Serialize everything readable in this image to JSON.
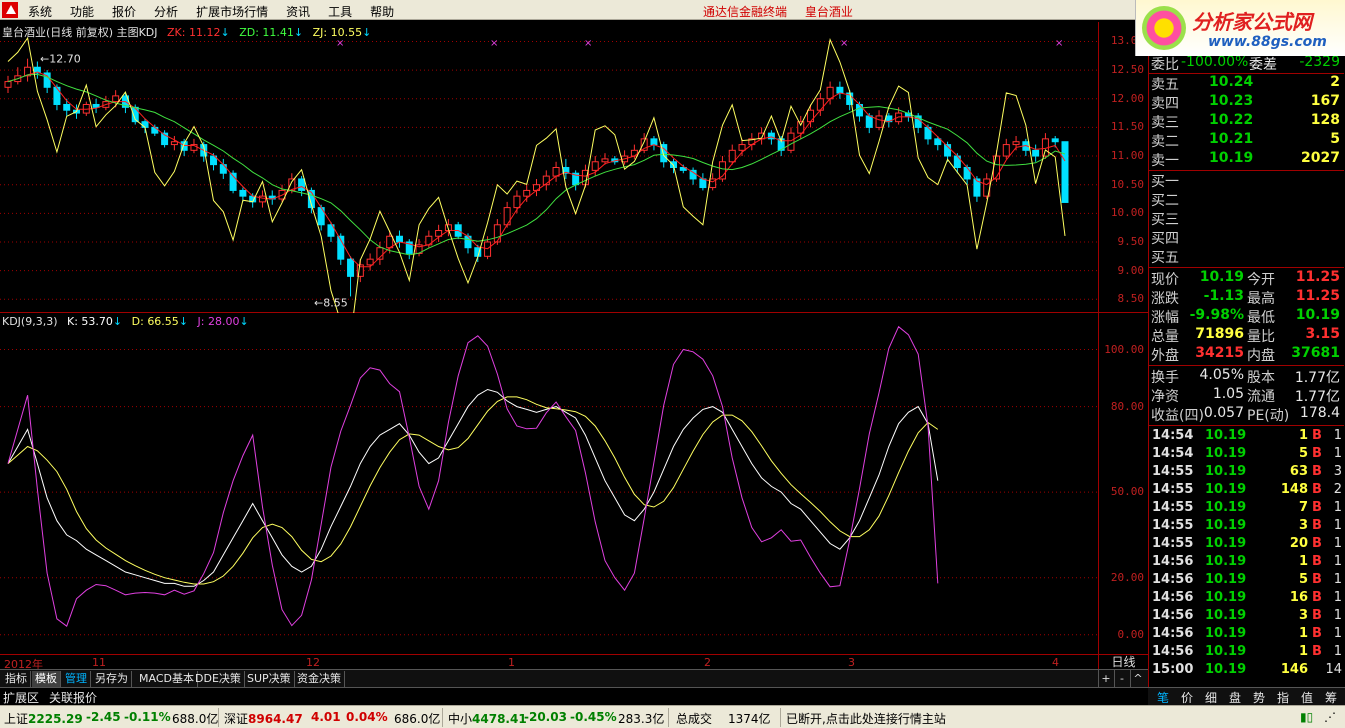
{
  "menu": {
    "items": [
      "系统",
      "功能",
      "报价",
      "分析",
      "扩展市场行情",
      "资讯",
      "工具",
      "帮助"
    ],
    "center": [
      "通达信金融终端",
      "皇台酒业"
    ]
  },
  "brand": {
    "name": "分析家公式网",
    "url": "www.88gs.com"
  },
  "price_pane": {
    "title": "皇台酒业(日线 前复权) 主图KDJ",
    "zk": "ZK: 11.12",
    "zd": "ZD: 11.41",
    "zj": "ZJ: 10.55",
    "max_label": "12.70",
    "min_label": "8.55",
    "y_ticks": [
      "13.00",
      "12.50",
      "12.00",
      "11.50",
      "11.00",
      "10.50",
      "10.00",
      "9.50",
      "9.00",
      "8.50"
    ]
  },
  "kdj_pane": {
    "title": "KDJ(9,3,3)",
    "k": "K: 53.70",
    "d": "D: 66.55",
    "j": "J: 28.00",
    "y_ticks": [
      "100.00",
      "80.00",
      "50.00",
      "20.00",
      "0.00"
    ]
  },
  "x_ticks": [
    "2012年",
    "11",
    "12",
    "1",
    "2",
    "3",
    "4"
  ],
  "period": "日线",
  "tabs": [
    "指标",
    "模板",
    "管理",
    "另存为",
    "MACD基本",
    "DDE决策",
    "SUP决策",
    "资金决策"
  ],
  "tab_controls": [
    "+",
    "-",
    "^"
  ],
  "subtabs": [
    "扩展区",
    "关联报价"
  ],
  "quote": {
    "header": {
      "label1": "委比",
      "value1": "-100.00%",
      "label2": "委差",
      "value2": "-2329"
    },
    "asks": [
      {
        "label": "卖五",
        "price": "10.24",
        "vol": "2"
      },
      {
        "label": "卖四",
        "price": "10.23",
        "vol": "167"
      },
      {
        "label": "卖三",
        "price": "10.22",
        "vol": "128"
      },
      {
        "label": "卖二",
        "price": "10.21",
        "vol": "5"
      },
      {
        "label": "卖一",
        "price": "10.19",
        "vol": "2027"
      }
    ],
    "bids": [
      {
        "label": "买一"
      },
      {
        "label": "买二"
      },
      {
        "label": "买三"
      },
      {
        "label": "买四"
      },
      {
        "label": "买五"
      }
    ],
    "stats": [
      {
        "l1": "现价",
        "v1": "10.19",
        "c1": "green",
        "l2": "今开",
        "v2": "11.25",
        "c2": "red"
      },
      {
        "l1": "涨跌",
        "v1": "-1.13",
        "c1": "green",
        "l2": "最高",
        "v2": "11.25",
        "c2": "red"
      },
      {
        "l1": "涨幅",
        "v1": "-9.98%",
        "c1": "green",
        "l2": "最低",
        "v2": "10.19",
        "c2": "green"
      },
      {
        "l1": "总量",
        "v1": "71896",
        "c1": "yellow",
        "l2": "量比",
        "v2": "3.15",
        "c2": "red"
      },
      {
        "l1": "外盘",
        "v1": "34215",
        "c1": "red",
        "l2": "内盘",
        "v2": "37681",
        "c2": "green"
      }
    ],
    "fundamentals": [
      {
        "l1": "换手",
        "v1": "4.05%",
        "l2": "股本",
        "v2": "1.77亿"
      },
      {
        "l1": "净资",
        "v1": "1.05",
        "l2": "流通",
        "v2": "1.77亿"
      },
      {
        "l1": "收益(四)",
        "v1": "0.057",
        "l2": "PE(动)",
        "v2": "178.4"
      }
    ],
    "trades": [
      {
        "time": "14:54",
        "price": "10.19",
        "vol": "1",
        "side": "B",
        "n": "1"
      },
      {
        "time": "14:54",
        "price": "10.19",
        "vol": "5",
        "side": "B",
        "n": "1"
      },
      {
        "time": "14:55",
        "price": "10.19",
        "vol": "63",
        "side": "B",
        "n": "3"
      },
      {
        "time": "14:55",
        "price": "10.19",
        "vol": "148",
        "side": "B",
        "n": "2"
      },
      {
        "time": "14:55",
        "price": "10.19",
        "vol": "7",
        "side": "B",
        "n": "1"
      },
      {
        "time": "14:55",
        "price": "10.19",
        "vol": "3",
        "side": "B",
        "n": "1"
      },
      {
        "time": "14:55",
        "price": "10.19",
        "vol": "20",
        "side": "B",
        "n": "1"
      },
      {
        "time": "14:56",
        "price": "10.19",
        "vol": "1",
        "side": "B",
        "n": "1"
      },
      {
        "time": "14:56",
        "price": "10.19",
        "vol": "5",
        "side": "B",
        "n": "1"
      },
      {
        "time": "14:56",
        "price": "10.19",
        "vol": "16",
        "side": "B",
        "n": "1"
      },
      {
        "time": "14:56",
        "price": "10.19",
        "vol": "3",
        "side": "B",
        "n": "1"
      },
      {
        "time": "14:56",
        "price": "10.19",
        "vol": "1",
        "side": "B",
        "n": "1"
      },
      {
        "time": "14:56",
        "price": "10.19",
        "vol": "1",
        "side": "B",
        "n": "1"
      },
      {
        "time": "15:00",
        "price": "10.19",
        "vol": "146",
        "side": "",
        "n": "14"
      }
    ]
  },
  "rp_tabs": [
    "笔",
    "价",
    "细",
    "盘",
    "势",
    "指",
    "值",
    "筹"
  ],
  "status": {
    "sh_name": "上证",
    "sh_val": "2225.29",
    "sh_chg": "-2.45",
    "sh_pct": "-0.11%",
    "sh_amt": "688.0亿",
    "sz_name": "深证",
    "sz_val": "8964.47",
    "sz_chg": "4.01",
    "sz_pct": "0.04%",
    "sz_amt": "686.0亿",
    "zx_name": "中小",
    "zx_val": "4478.41",
    "zx_chg": "-20.03",
    "zx_pct": "-0.45%",
    "zx_amt": "283.3亿",
    "total_label": "总成交",
    "total_val": "1374亿",
    "msg": "已断开,点击此处连接行情主站"
  },
  "colors": {
    "up": "#ff3030",
    "down": "#00e0ff",
    "k_line": "#ffffff",
    "d_line": "#ffff60",
    "j_line": "#e040e0",
    "ma_red": "#ff2020",
    "ma_green": "#40e040",
    "ma_yellow": "#ffff60",
    "grid": "#a00000"
  },
  "chart_data": {
    "type": "line",
    "price_ylim": [
      8.4,
      13.2
    ],
    "kdj_ylim": [
      -5,
      110
    ],
    "candles": [
      [
        12.2,
        12.3,
        12.1,
        12.4
      ],
      [
        12.3,
        12.4,
        12.25,
        12.55
      ],
      [
        12.4,
        12.55,
        12.3,
        12.7
      ],
      [
        12.55,
        12.45,
        12.35,
        12.65
      ],
      [
        12.45,
        12.2,
        12.1,
        12.5
      ],
      [
        12.2,
        11.9,
        11.8,
        12.25
      ],
      [
        11.9,
        11.8,
        11.7,
        12.0
      ],
      [
        11.8,
        11.75,
        11.65,
        11.9
      ],
      [
        11.75,
        11.9,
        11.7,
        11.95
      ],
      [
        11.9,
        11.85,
        11.75,
        12.0
      ],
      [
        11.85,
        11.95,
        11.8,
        12.05
      ],
      [
        11.95,
        12.05,
        11.85,
        12.15
      ],
      [
        12.05,
        11.85,
        11.75,
        12.1
      ],
      [
        11.85,
        11.6,
        11.55,
        11.9
      ],
      [
        11.6,
        11.5,
        11.4,
        11.65
      ],
      [
        11.5,
        11.4,
        11.35,
        11.55
      ],
      [
        11.4,
        11.2,
        11.15,
        11.45
      ],
      [
        11.2,
        11.25,
        11.1,
        11.35
      ],
      [
        11.25,
        11.1,
        11.0,
        11.3
      ],
      [
        11.1,
        11.2,
        11.05,
        11.3
      ],
      [
        11.2,
        11.0,
        10.9,
        11.25
      ],
      [
        11.0,
        10.85,
        10.75,
        11.05
      ],
      [
        10.85,
        10.7,
        10.6,
        10.95
      ],
      [
        10.7,
        10.4,
        10.35,
        10.75
      ],
      [
        10.4,
        10.3,
        10.2,
        10.45
      ],
      [
        10.3,
        10.2,
        10.1,
        10.35
      ],
      [
        10.2,
        10.3,
        10.1,
        10.4
      ],
      [
        10.3,
        10.25,
        10.15,
        10.4
      ],
      [
        10.25,
        10.4,
        10.2,
        10.5
      ],
      [
        10.4,
        10.6,
        10.35,
        10.7
      ],
      [
        10.6,
        10.4,
        10.3,
        10.65
      ],
      [
        10.4,
        10.1,
        10.0,
        10.45
      ],
      [
        10.1,
        9.8,
        9.7,
        10.15
      ],
      [
        9.8,
        9.6,
        9.5,
        9.85
      ],
      [
        9.6,
        9.2,
        9.1,
        9.65
      ],
      [
        9.2,
        8.9,
        8.55,
        9.25
      ],
      [
        8.9,
        9.1,
        8.8,
        9.2
      ],
      [
        9.1,
        9.2,
        9.0,
        9.3
      ],
      [
        9.2,
        9.4,
        9.1,
        9.5
      ],
      [
        9.4,
        9.6,
        9.3,
        9.7
      ],
      [
        9.6,
        9.5,
        9.4,
        9.7
      ],
      [
        9.5,
        9.3,
        9.2,
        9.55
      ],
      [
        9.3,
        9.45,
        9.25,
        9.55
      ],
      [
        9.45,
        9.6,
        9.4,
        9.7
      ],
      [
        9.6,
        9.7,
        9.5,
        9.8
      ],
      [
        9.7,
        9.8,
        9.6,
        9.9
      ],
      [
        9.8,
        9.6,
        9.55,
        9.85
      ],
      [
        9.6,
        9.4,
        9.3,
        9.65
      ],
      [
        9.4,
        9.25,
        9.15,
        9.45
      ],
      [
        9.25,
        9.5,
        9.2,
        9.6
      ],
      [
        9.5,
        9.8,
        9.45,
        9.9
      ],
      [
        9.8,
        10.1,
        9.75,
        10.2
      ],
      [
        10.1,
        10.3,
        10.0,
        10.4
      ],
      [
        10.3,
        10.4,
        10.2,
        10.5
      ],
      [
        10.4,
        10.5,
        10.3,
        10.6
      ],
      [
        10.5,
        10.65,
        10.4,
        10.75
      ],
      [
        10.65,
        10.8,
        10.55,
        10.9
      ],
      [
        10.8,
        10.7,
        10.6,
        10.95
      ],
      [
        10.7,
        10.5,
        10.4,
        10.75
      ],
      [
        10.5,
        10.75,
        10.45,
        10.85
      ],
      [
        10.75,
        10.9,
        10.65,
        11.0
      ],
      [
        10.9,
        10.95,
        10.85,
        11.05
      ],
      [
        10.95,
        10.9,
        10.85,
        11.0
      ],
      [
        10.9,
        11.0,
        10.85,
        11.1
      ],
      [
        11.0,
        11.1,
        10.95,
        11.2
      ],
      [
        11.1,
        11.3,
        11.05,
        11.4
      ],
      [
        11.3,
        11.2,
        11.1,
        11.35
      ],
      [
        11.2,
        10.9,
        10.8,
        11.25
      ],
      [
        10.9,
        10.8,
        10.7,
        10.95
      ],
      [
        10.8,
        10.75,
        10.7,
        10.85
      ],
      [
        10.75,
        10.6,
        10.5,
        10.8
      ],
      [
        10.6,
        10.45,
        10.4,
        10.7
      ],
      [
        10.45,
        10.6,
        10.4,
        10.7
      ],
      [
        10.6,
        10.9,
        10.55,
        11.0
      ],
      [
        10.9,
        11.1,
        10.85,
        11.2
      ],
      [
        11.1,
        11.2,
        11.0,
        11.3
      ],
      [
        11.2,
        11.3,
        11.1,
        11.4
      ],
      [
        11.3,
        11.4,
        11.2,
        11.5
      ],
      [
        11.4,
        11.3,
        11.2,
        11.45
      ],
      [
        11.3,
        11.1,
        11.0,
        11.35
      ],
      [
        11.1,
        11.4,
        11.05,
        11.5
      ],
      [
        11.4,
        11.6,
        11.3,
        11.7
      ],
      [
        11.6,
        11.8,
        11.5,
        11.9
      ],
      [
        11.8,
        12.0,
        11.7,
        12.1
      ],
      [
        12.0,
        12.2,
        11.9,
        12.3
      ],
      [
        12.2,
        12.1,
        12.0,
        12.3
      ],
      [
        12.1,
        11.9,
        11.8,
        12.15
      ],
      [
        11.9,
        11.7,
        11.6,
        11.95
      ],
      [
        11.7,
        11.5,
        11.4,
        11.75
      ],
      [
        11.5,
        11.7,
        11.45,
        11.8
      ],
      [
        11.7,
        11.6,
        11.5,
        11.75
      ],
      [
        11.6,
        11.75,
        11.55,
        11.85
      ],
      [
        11.75,
        11.7,
        11.6,
        11.8
      ],
      [
        11.7,
        11.5,
        11.4,
        11.75
      ],
      [
        11.5,
        11.3,
        11.2,
        11.55
      ],
      [
        11.3,
        11.2,
        11.1,
        11.35
      ],
      [
        11.2,
        11.0,
        10.9,
        11.25
      ],
      [
        11.0,
        10.8,
        10.7,
        11.05
      ],
      [
        10.8,
        10.6,
        10.5,
        10.85
      ],
      [
        10.6,
        10.3,
        10.2,
        10.65
      ],
      [
        10.3,
        10.6,
        10.25,
        10.7
      ],
      [
        10.6,
        11.0,
        10.55,
        11.1
      ],
      [
        11.0,
        11.2,
        10.95,
        11.3
      ],
      [
        11.2,
        11.25,
        11.1,
        11.35
      ],
      [
        11.25,
        11.1,
        11.0,
        11.3
      ],
      [
        11.1,
        11.0,
        10.9,
        11.2
      ],
      [
        11.0,
        11.3,
        10.95,
        11.4
      ],
      [
        11.3,
        11.25,
        11.15,
        11.35
      ],
      [
        11.25,
        10.19,
        10.19,
        11.25
      ]
    ],
    "kdj_k": [
      60,
      66,
      72,
      60,
      48,
      40,
      35,
      33,
      30,
      28,
      26,
      24,
      22,
      21,
      20,
      19,
      18,
      18,
      17,
      17,
      19,
      22,
      28,
      34,
      40,
      46,
      40,
      34,
      28,
      24,
      22,
      24,
      30,
      38,
      45,
      52,
      60,
      66,
      70,
      72,
      74,
      70,
      64,
      60,
      62,
      68,
      74,
      80,
      84,
      86,
      85,
      82,
      80,
      79,
      78,
      79,
      80,
      78,
      76,
      70,
      62,
      54,
      48,
      42,
      40,
      44,
      50,
      58,
      66,
      72,
      76,
      79,
      80,
      78,
      72,
      66,
      60,
      55,
      52,
      50,
      46,
      44,
      40,
      36,
      32,
      30,
      34,
      40,
      48,
      56,
      66,
      74,
      78,
      80,
      74,
      54
    ]
  }
}
